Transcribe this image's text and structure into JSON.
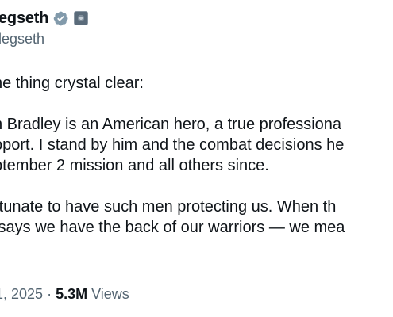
{
  "author": {
    "display_name": "egseth",
    "handle": "legseth",
    "verified_badge_icon": "verified-badge-icon",
    "affiliate_badge_icon": "affiliation-badge-icon",
    "verified_color": "#829aab"
  },
  "tweet": {
    "paragraphs": [
      [
        "ne thing crystal clear:"
      ],
      [
        "h Bradley is an American hero, a true professiona",
        "pport. I stand by him and the combat decisions he",
        "ptember 2 mission and all others since."
      ],
      [
        "rtunate to have such men protecting us. When th",
        " says we have the back of our warriors — we mea"
      ]
    ]
  },
  "meta": {
    "date": "1, 2025",
    "separator": " · ",
    "views_count": "5.3M",
    "views_label": " Views"
  }
}
